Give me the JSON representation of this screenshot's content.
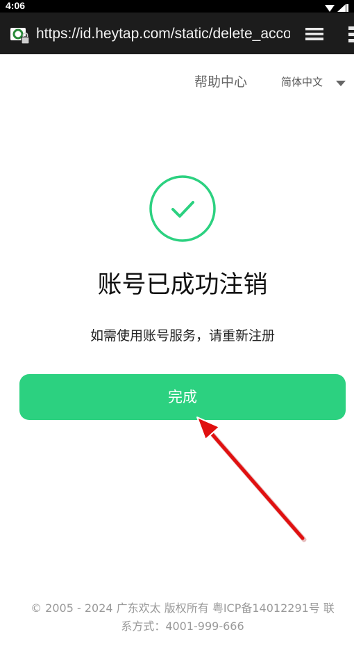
{
  "status_bar": {
    "time": "4:06",
    "icons": [
      "wifi-icon",
      "signal-icon",
      "battery-icon"
    ]
  },
  "browser": {
    "url": "https://id.heytap.com/static/delete_account",
    "icons": [
      "site-security-icon",
      "tabs-icon",
      "menu-icon"
    ]
  },
  "header": {
    "help_link": "帮助中心",
    "language": "简体中文"
  },
  "main": {
    "title": "账号已成功注销",
    "subtitle": "如需使用账号服务，请重新注册",
    "done_button": "完成"
  },
  "footer": {
    "line1": "© 2005 - 2024 广东欢太 版权所有 粤ICP备14012291号 联",
    "line2": "系方式：4001-999-666"
  },
  "colors": {
    "accent": "#2cd180",
    "annotation_arrow": "#e01010",
    "browser_bar": "#1c1c1c"
  }
}
